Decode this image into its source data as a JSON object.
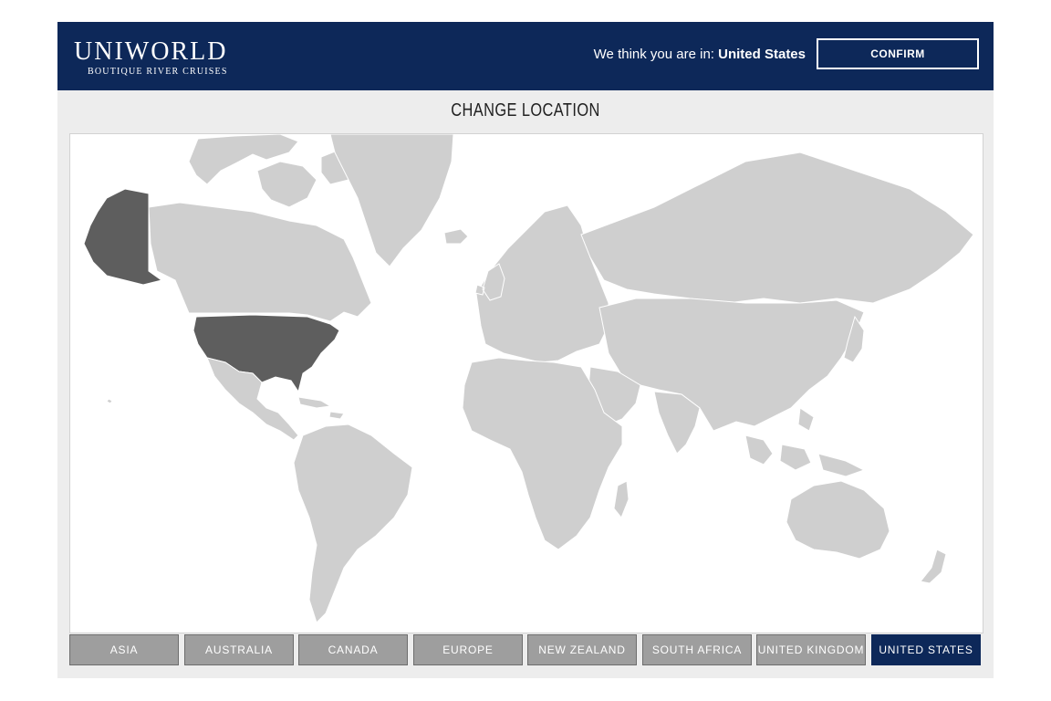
{
  "header": {
    "logo_main": "UNIWORLD",
    "logo_sub": "BOUTIQUE RIVER CRUISES",
    "location_prompt": "We think you are in:",
    "location_value": "United States",
    "confirm_label": "CONFIRM"
  },
  "title": "CHANGE LOCATION",
  "colors": {
    "brand_navy": "#0d2859",
    "land_gray": "#cfcfcf",
    "selected_country": "#5e5e5e",
    "button_gray": "#9e9e9e"
  },
  "regions": [
    {
      "label": "ASIA",
      "active": false
    },
    {
      "label": "AUSTRALIA",
      "active": false
    },
    {
      "label": "CANADA",
      "active": false
    },
    {
      "label": "EUROPE",
      "active": false
    },
    {
      "label": "NEW ZEALAND",
      "active": false
    },
    {
      "label": "SOUTH AFRICA",
      "active": false
    },
    {
      "label": "UNITED KINGDOM",
      "active": false
    },
    {
      "label": "UNITED STATES",
      "active": true
    }
  ]
}
